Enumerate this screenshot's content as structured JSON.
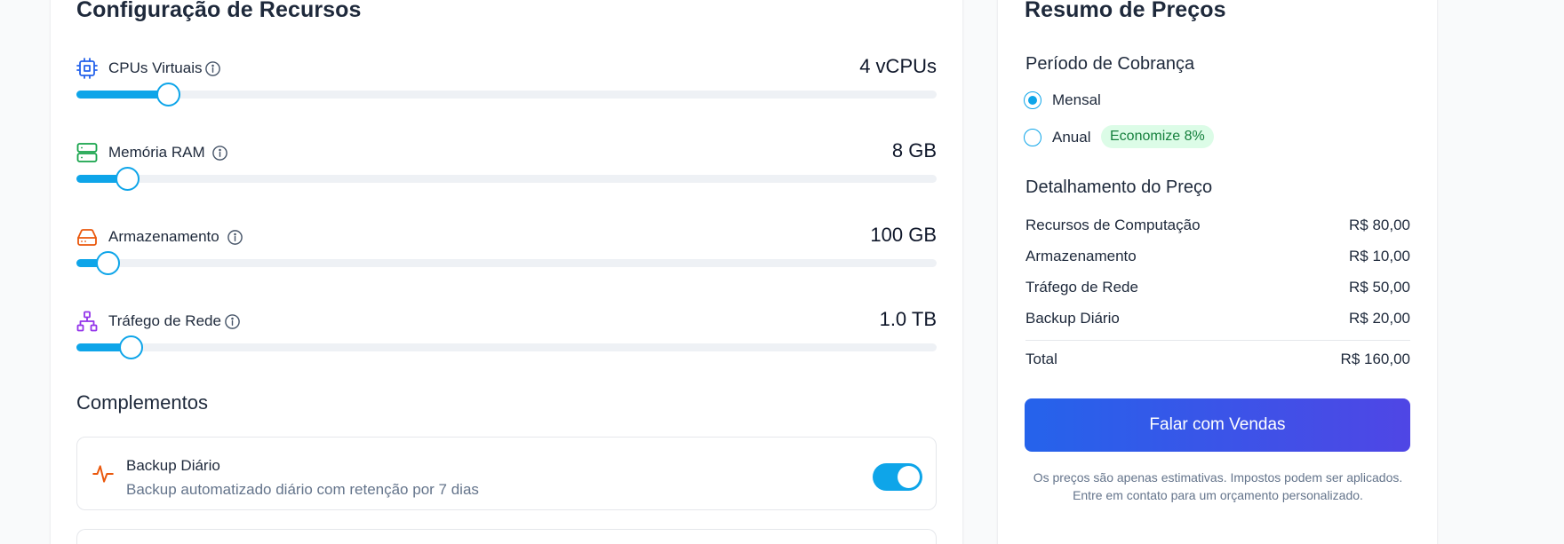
{
  "resources": {
    "title": "Configuração de Recursos",
    "sliders": [
      {
        "label": "CPUs Virtuais",
        "value": "4 vCPUs",
        "level": 0.107,
        "icon": "cpu-icon",
        "color": "#2563eb"
      },
      {
        "label": "Memória RAM",
        "value": "8 GB",
        "level": 0.059,
        "icon": "server-icon",
        "color": "#16a34a"
      },
      {
        "label": "Armazenamento",
        "value": "100 GB",
        "level": 0.037,
        "icon": "hard-drive-icon",
        "color": "#ea580c"
      },
      {
        "label": "Tráfego de Rede",
        "value": "1.0 TB",
        "level": 0.064,
        "icon": "network-icon",
        "color": "#9333ea"
      }
    ],
    "addons_title": "Complementos",
    "addons": [
      {
        "title": "Backup Diário",
        "description": "Backup automatizado diário com retenção por 7 dias",
        "enabled": true,
        "icon": "activity-icon",
        "color": "#ea580c"
      }
    ]
  },
  "summary": {
    "title": "Resumo de Preços",
    "billing_label": "Período de Cobrança",
    "billing_options": [
      {
        "label": "Mensal",
        "selected": true
      },
      {
        "label": "Anual",
        "selected": false,
        "badge": "Economize 8%"
      }
    ],
    "breakdown_label": "Detalhamento do Preço",
    "items": [
      {
        "name": "Recursos de Computação",
        "amount": "R$ 80,00"
      },
      {
        "name": "Armazenamento",
        "amount": "R$ 10,00"
      },
      {
        "name": "Tráfego de Rede",
        "amount": "R$ 50,00"
      },
      {
        "name": "Backup Diário",
        "amount": "R$ 20,00"
      }
    ],
    "total": {
      "name": "Total",
      "amount": "R$ 160,00"
    },
    "cta": "Falar com Vendas",
    "note": "Os preços são apenas estimativas. Impostos podem ser aplicados. Entre em contato para um orçamento personalizado.",
    "accent": "#0ea5e9"
  }
}
